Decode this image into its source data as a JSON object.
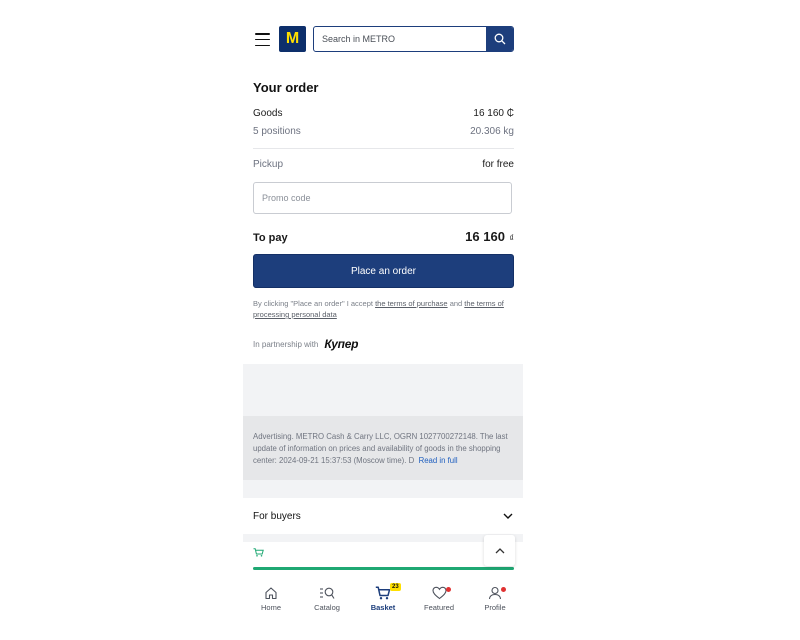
{
  "header": {
    "logo_text": "M",
    "search_placeholder": "Search in METRO"
  },
  "order": {
    "title": "Your order",
    "goods_label": "Goods",
    "goods_value": "16 160 ₵",
    "positions_label": "5 positions",
    "weight_value": "20.306 kg",
    "pickup_label": "Pickup",
    "pickup_value": "for free",
    "promo_placeholder": "Promo code",
    "topay_label": "To pay",
    "topay_value": "16 160",
    "topay_currency": "₫",
    "place_order_label": "Place an order",
    "legal_prefix": "By clicking \"Place an order\" I accept ",
    "terms_purchase_link": "the terms of purchase",
    "legal_and": " and ",
    "terms_data_link": "the terms of processing personal data",
    "partnership_label": "In partnership with",
    "partner_brand": "Купер"
  },
  "ad": {
    "text": "Advertising. METRO Cash & Carry LLC, OGRN 1027700272148. The last update of information on prices and availability of goods in the shopping center: 2024-09-21 15:37:53 (Moscow time). D",
    "read_more": "Read in full"
  },
  "buyers": {
    "label": "For buyers"
  },
  "basket_progress": 1.0,
  "nav": {
    "items": [
      {
        "label": "Home",
        "icon": "home-icon"
      },
      {
        "label": "Catalog",
        "icon": "catalog-search-icon"
      },
      {
        "label": "Basket",
        "icon": "cart-icon",
        "badge": "23",
        "active": true
      },
      {
        "label": "Featured",
        "icon": "heart-icon"
      },
      {
        "label": "Profile",
        "icon": "user-icon"
      }
    ]
  },
  "colors": {
    "brand_blue": "#1d3e7c",
    "brand_yellow": "#ffe000",
    "progress_green": "#1fa873",
    "alert_red": "#e03131"
  }
}
